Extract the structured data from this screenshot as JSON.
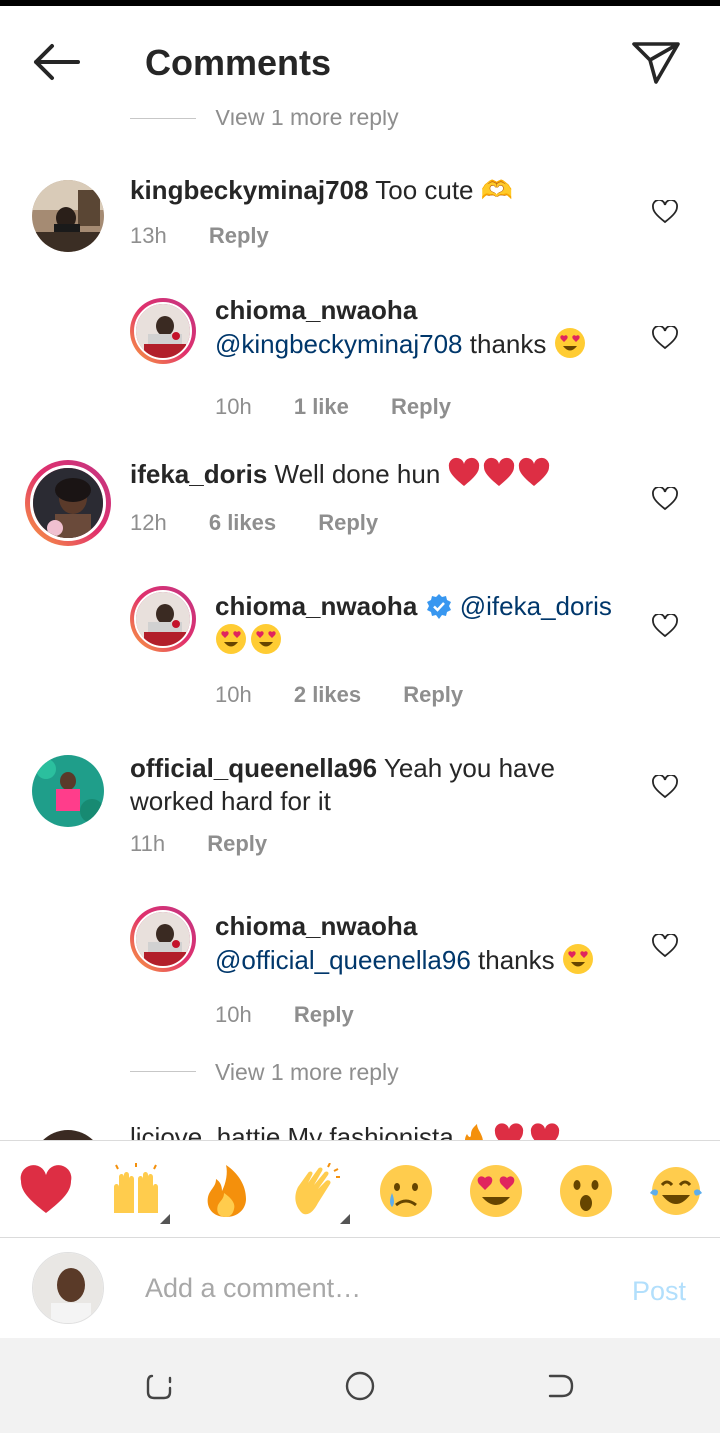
{
  "header": {
    "title": "Comments"
  },
  "feed": {
    "clipped_view_more": "View 1 more reply",
    "comments": [
      {
        "username": "kingbeckyminaj708",
        "text": "Too cute 🫶",
        "time": "13h",
        "reply_label": "Reply"
      },
      {
        "username": "chioma_nwaoha",
        "mention": "@kingbeckyminaj708",
        "text": "thanks",
        "time": "10h",
        "likes": "1 like",
        "reply_label": "Reply"
      },
      {
        "username": "ifeka_doris",
        "text": "Well done hun",
        "time": "12h",
        "likes": "6 likes",
        "reply_label": "Reply"
      },
      {
        "username": "chioma_nwaoha",
        "mention": "@ifeka_doris",
        "time": "10h",
        "likes": "2 likes",
        "reply_label": "Reply"
      },
      {
        "username": "official_queenella96",
        "text": "Yeah you have worked hard for it",
        "time": "11h",
        "reply_label": "Reply"
      },
      {
        "username": "chioma_nwaoha",
        "mention": "@official_queenella96",
        "text": "thanks",
        "time": "10h",
        "reply_label": "Reply"
      }
    ],
    "view_more": "View 1 more reply",
    "partial_comment": "liciove_hattie My fashionista"
  },
  "reactions": [
    "red-heart",
    "raising-hands",
    "fire",
    "clapping-hands",
    "crying-face",
    "heart-eyes",
    "surprised-face",
    "tears-of-joy"
  ],
  "composer": {
    "placeholder": "Add a comment…",
    "post_label": "Post"
  },
  "colors": {
    "text": "#262626",
    "secondary": "#8e8e8e",
    "mention": "#00376b",
    "post_disabled": "#b2dffc",
    "verified": "#3897f0"
  },
  "icons": [
    "back-arrow-icon",
    "send-icon",
    "heart-icon",
    "verified-badge-icon",
    "recents-icon",
    "home-icon",
    "back-nav-icon"
  ]
}
